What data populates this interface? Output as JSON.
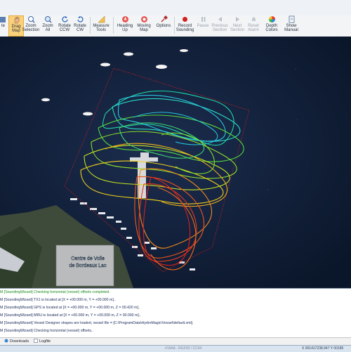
{
  "ribbon": {
    "buttons": [
      {
        "label": "te",
        "icon": "partial-icon"
      },
      {
        "label": "Drag Map",
        "icon": "hand-icon"
      },
      {
        "label": "Zoom Selection",
        "icon": "zoom-selection-icon"
      },
      {
        "label": "Zoom All",
        "icon": "zoom-all-icon"
      },
      {
        "label": "Rotate CCW",
        "icon": "rotate-ccw-icon"
      },
      {
        "label": "Rotate CW",
        "icon": "rotate-cw-icon"
      },
      {
        "label": "Measure Tools",
        "icon": "ruler-icon"
      },
      {
        "label": "Heading Up",
        "icon": "heading-up-icon"
      },
      {
        "label": "Moving Map",
        "icon": "moving-map-icon"
      },
      {
        "label": "Options",
        "icon": "wrench-icon"
      },
      {
        "label": "Record Sounding",
        "icon": "record-icon"
      },
      {
        "label": "Pause",
        "icon": "pause-icon"
      },
      {
        "label": "Previous Section",
        "icon": "previous-icon"
      },
      {
        "label": "Next Section",
        "icon": "next-icon"
      },
      {
        "label": "Reset Alarm",
        "icon": "alarm-icon"
      },
      {
        "label": "Depth Colors",
        "icon": "color-wheel-icon"
      },
      {
        "label": "Show Manual",
        "icon": "manual-icon"
      }
    ]
  },
  "map": {
    "label": "Centre de Voile de Bordeaux Lac"
  },
  "log": {
    "lines": [
      "M [SoundingWizard] Checking horizontal (vessel) offsets completed.",
      "M [SoundingWizard] TX1 is located at [X = +00.000 m, Y = +00.000 m]..",
      "M [SoundingWizard] GPS is located at [X = +00.000 m, Y = +00.000 m, Z = 00.420 m]..",
      "M [SoundingWizard] MRU is located at [X = +00.000 m, Y = +00.000 m, Z = 00.000 m]..",
      "M [SoundingWizard] Vessel Designer shapes are loaded, vessel file = [C:\\ProgramData\\HydroMagic\\Vessel\\default.xml].",
      "M [SoundingWizard] Checking horizontal (vessel) offsets.."
    ]
  },
  "tabs": [
    {
      "label": "Downloads",
      "icon": "download-icon"
    },
    {
      "label": "Logfile",
      "icon": "logfile-icon"
    }
  ],
  "status": {
    "center": "#19AA - RGF93 / CC44",
    "coords": "X 001417238.947   Y 00185"
  }
}
